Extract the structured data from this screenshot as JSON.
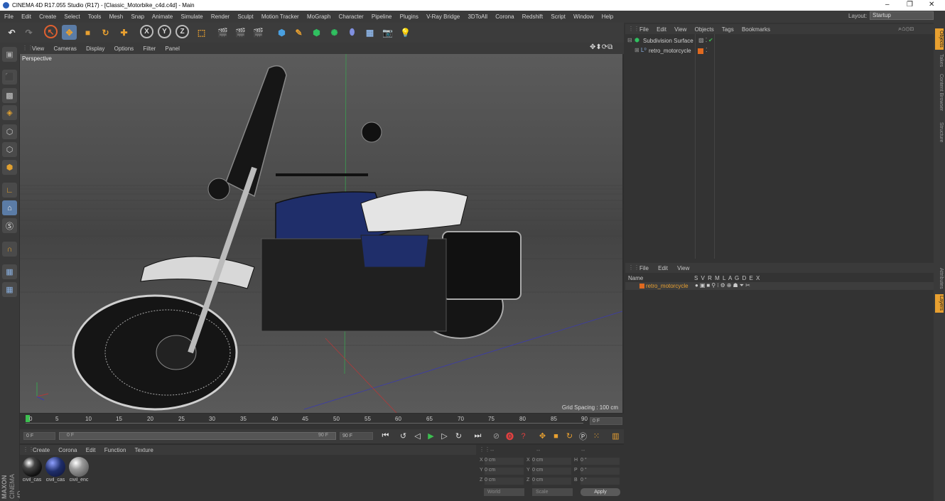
{
  "window": {
    "title": "CINEMA 4D R17.055 Studio (R17) - [Classic_Motorbike_c4d.c4d] - Main",
    "minimize": "–",
    "restore": "❐",
    "close": "✕"
  },
  "menubar": {
    "items": [
      "File",
      "Edit",
      "Create",
      "Select",
      "Tools",
      "Mesh",
      "Snap",
      "Animate",
      "Simulate",
      "Render",
      "Sculpt",
      "Motion Tracker",
      "MoGraph",
      "Character",
      "Pipeline",
      "Plugins",
      "V-Ray Bridge",
      "3DToAll",
      "Corona",
      "Redshift",
      "Script",
      "Window",
      "Help"
    ],
    "layout_label": "Layout:",
    "layout_value": "Startup"
  },
  "toolbar": {
    "axis_x": "X",
    "axis_y": "Y",
    "axis_z": "Z"
  },
  "viewport": {
    "menu": [
      "View",
      "Cameras",
      "Display",
      "Options",
      "Filter",
      "Panel"
    ],
    "label": "Perspective",
    "grid_spacing": "Grid Spacing : 100 cm"
  },
  "timeline": {
    "ticks": [
      "0",
      "5",
      "10",
      "15",
      "20",
      "25",
      "30",
      "35",
      "40",
      "45",
      "50",
      "55",
      "60",
      "65",
      "70",
      "75",
      "80",
      "85",
      "90"
    ],
    "current_frame": "0 F"
  },
  "transport": {
    "start": "0 F",
    "range_start": "0 F",
    "range_end": "90 F",
    "end": "90 F"
  },
  "materials": {
    "menu": [
      "Create",
      "Corona",
      "Edit",
      "Function",
      "Texture"
    ],
    "items": [
      {
        "label": "civil_cas"
      },
      {
        "label": "civil_cas"
      },
      {
        "label": "civil_enc"
      }
    ]
  },
  "coordinates": {
    "rows": [
      {
        "a": "X",
        "av": "0 cm",
        "b": "X",
        "bv": "0 cm",
        "c": "H",
        "cv": "0 °"
      },
      {
        "a": "Y",
        "av": "0 cm",
        "b": "Y",
        "bv": "0 cm",
        "c": "P",
        "cv": "0 °"
      },
      {
        "a": "Z",
        "av": "0 cm",
        "b": "Z",
        "bv": "0 cm",
        "c": "B",
        "cv": "0 °"
      }
    ],
    "world": "World",
    "scale": "Scale",
    "apply": "Apply",
    "sep": "--"
  },
  "objects": {
    "menu": [
      "File",
      "Edit",
      "View",
      "Objects",
      "Tags",
      "Bookmarks"
    ],
    "items": [
      "Subdivision Surface",
      "retro_motorcycle"
    ]
  },
  "layers": {
    "menu": [
      "File",
      "Edit",
      "View"
    ],
    "header_name": "Name",
    "header_flags": "S V R M L A G D E X",
    "row": "retro_motorcycle"
  },
  "right_tabs": [
    "Objects",
    "Takes",
    "Content Browser",
    "Structure",
    "Attributes",
    "Layers"
  ],
  "branding": {
    "maxon": "MAXON",
    "c4d": "CINEMA 4D"
  }
}
